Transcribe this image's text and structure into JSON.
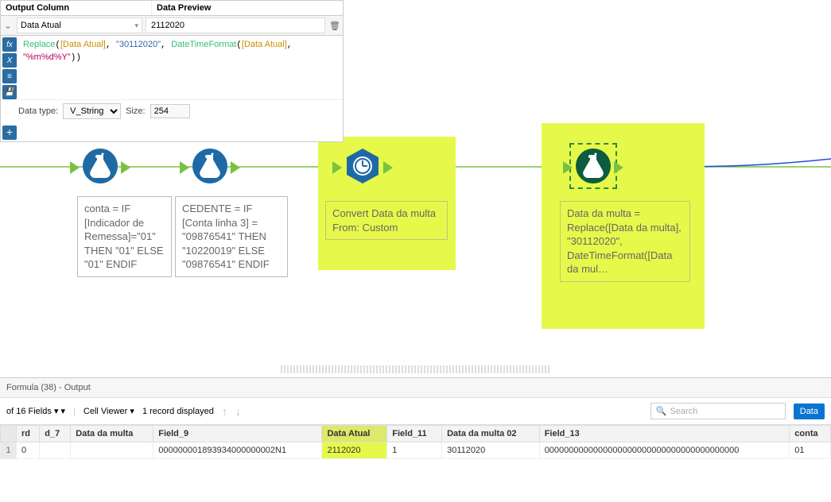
{
  "config": {
    "headers": {
      "output_column": "Output Column",
      "data_preview": "Data Preview"
    },
    "field_name": "Data Atual",
    "preview_value": "2112020",
    "formula_tokens": {
      "fn_replace": "Replace",
      "field_data_atual": "[Data Atual]",
      "str_date": "\"30112020\"",
      "fn_datetimeformat": "DateTimeFormat",
      "fmt": "\"%m%d%Y\""
    },
    "datatype_label": "Data type:",
    "datatype_value": "V_String",
    "size_label": "Size:",
    "size_value": "254"
  },
  "nodes": {
    "n1_annotation": "conta = IF [Indicador de Remessa]=\"01\" THEN \"01\" ELSE \"01\" ENDIF",
    "n2_annotation": "CEDENTE = IF [Conta linha 3] = \"09876541\" THEN \"10220019\" ELSE \"09876541\" ENDIF",
    "n3_annotation": "Convert Data da multa From: Custom",
    "n4_annotation": "Data da multa = Replace([Data da multa], \"30112020\", DateTimeFormat([Data da mul…"
  },
  "results": {
    "title": "Formula (38) - Output",
    "fields_label": "of 16 Fields",
    "cell_viewer_label": "Cell Viewer",
    "record_count_label": "1 record displayed",
    "search_placeholder": "Search",
    "data_button": "Data",
    "columns": [
      "rd",
      "d_7",
      "Data da multa",
      "Field_9",
      "Data Atual",
      "Field_11",
      "Data da multa 02",
      "Field_13",
      "conta"
    ],
    "rows": [
      {
        "rownum": "1",
        "cells": [
          "0",
          "",
          "",
          "000000001893934000000002N1",
          "2112020",
          "1",
          "30112020",
          "0000000000000000000000000000000000000000",
          "01"
        ]
      }
    ],
    "highlighted_column": "Data Atual"
  },
  "icons": {
    "fx": "fx",
    "x": "X",
    "list": "≡",
    "save": "💾",
    "plus": "+",
    "trash": "🗑",
    "chevron": "⌄",
    "dropdown": "▾",
    "search": "🔍",
    "up": "↑",
    "down": "↓"
  }
}
